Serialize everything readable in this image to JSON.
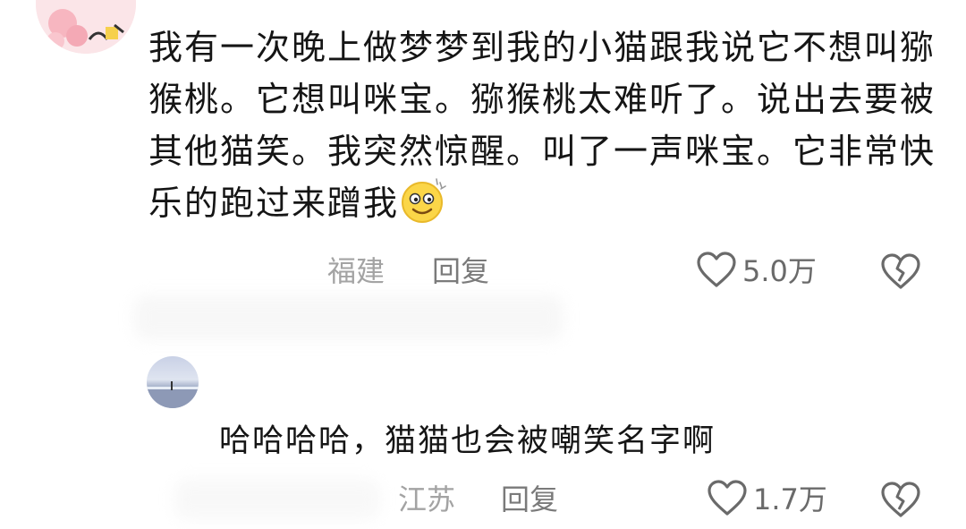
{
  "comments": [
    {
      "text": "我有一次晚上做梦梦到我的小猫跟我说它不想叫猕猴桃。它想叫咪宝。猕猴桃太难听了。说出去要被其他猫笑。我突然惊醒。叫了一声咪宝。它非常快乐的跑过来蹭我",
      "emoji": "dizzy-smile-emoji",
      "location": "福建",
      "reply_label": "回复",
      "likes": "5.0万"
    },
    {
      "text": "哈哈哈哈，猫猫也会被嘲笑名字啊",
      "location": "江苏",
      "reply_label": "回复",
      "likes": "1.7万"
    }
  ],
  "colors": {
    "text": "#151515",
    "meta": "#a3a3a3",
    "icon": "#6a6a6a"
  }
}
